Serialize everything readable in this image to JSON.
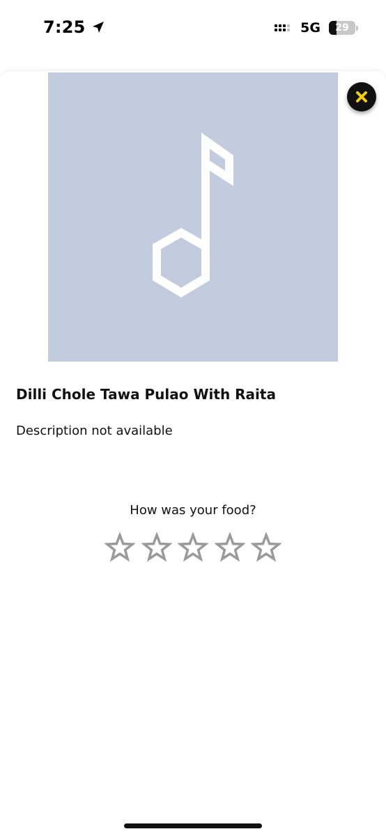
{
  "status_bar": {
    "time": "7:25",
    "location_icon": "location-arrow-icon",
    "signal_icon": "cellular-signal-icon",
    "network": "5G",
    "battery_level": "29",
    "battery_fraction": 0.29
  },
  "item": {
    "image_placeholder_icon": "music-note-icon",
    "image_background": "#c3cbde",
    "title": "Dilli Chole Tawa Pulao With Raita",
    "description": "Description not available"
  },
  "close_button": {
    "icon": "close-icon",
    "icon_color": "#f5d000"
  },
  "rating": {
    "prompt": "How was your food?",
    "max_stars": 5,
    "selected_stars": 0,
    "star_outline_color": "#9a9a9a"
  }
}
